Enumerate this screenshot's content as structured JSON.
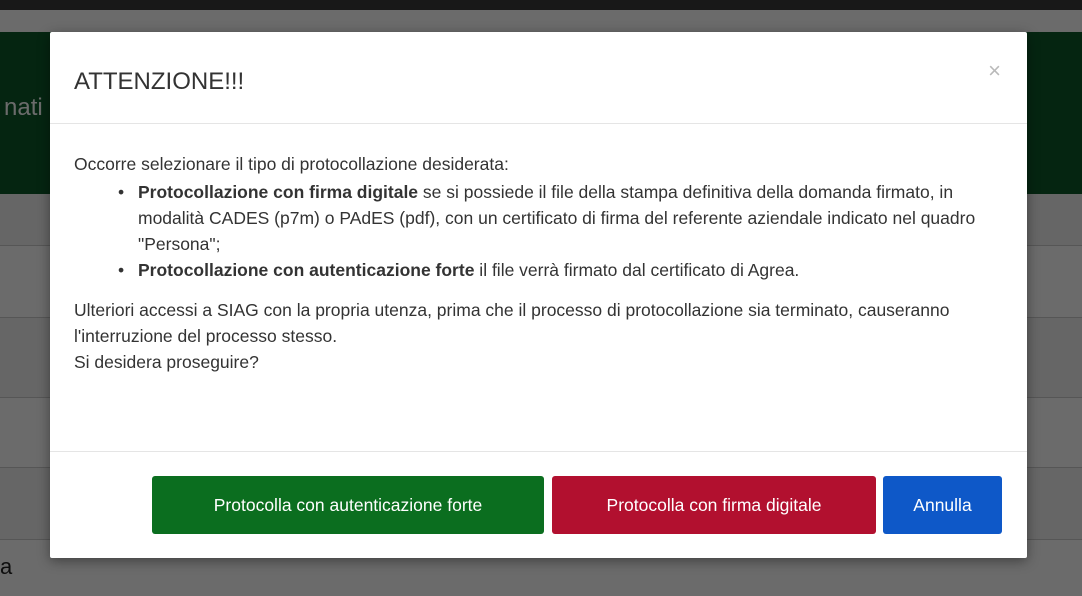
{
  "background": {
    "header_text": "nati",
    "bottom_text": "a"
  },
  "modal": {
    "title": "ATTENZIONE!!!",
    "close_label": "×",
    "intro": "Occorre selezionare il tipo di protocollazione desiderata:",
    "options": [
      {
        "bold": "Protocollazione con firma digitale",
        "rest": " se si possiede il file della stampa definitiva della domanda firmato, in modalità CADES (p7m) o PAdES (pdf), con un certificato di firma del referente aziendale indicato nel quadro \"Persona\";"
      },
      {
        "bold": "Protocollazione con autenticazione forte",
        "rest": " il file verrà firmato dal certificato di Agrea."
      }
    ],
    "warning_line1": "Ulteriori accessi a SIAG con la propria utenza, prima che il processo di protocollazione sia terminato, causeranno l'interruzione del processo stesso.",
    "warning_line2": "Si desidera proseguire?",
    "buttons": {
      "strong_auth": "Protocolla con autenticazione forte",
      "digital_sign": "Protocolla con firma digitale",
      "cancel": "Annulla"
    }
  },
  "colors": {
    "header_green": "#0c5a2a",
    "btn_green": "#0b6e1f",
    "btn_red": "#b2102f",
    "btn_blue": "#0e58c8"
  }
}
